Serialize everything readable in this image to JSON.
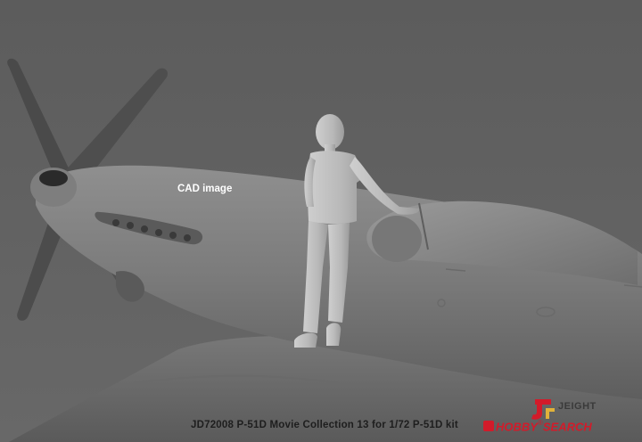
{
  "image": {
    "label": "CAD image",
    "caption": "JD72008 P-51D Movie Collection 13 for 1/72 P-51D kit"
  },
  "watermark": {
    "brand_top": "JEIGHT",
    "brand_hobby": "HOBBY",
    "brand_search": "SEARCH",
    "registered": "®",
    "accent_color": "#d21b2a"
  },
  "colors": {
    "background": "#606060",
    "model_gray": "#8a8a8a"
  }
}
